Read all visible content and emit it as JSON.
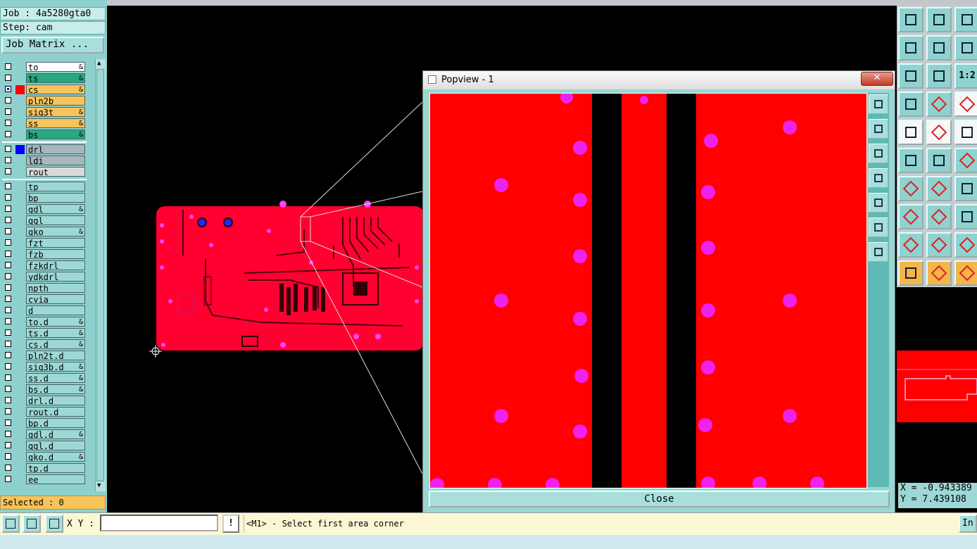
{
  "job": {
    "job_text": "Job : 4a5280gta0",
    "step_text": "Step: cam",
    "matrix_button": "Job Matrix ..."
  },
  "layers_top": [
    {
      "name": "to",
      "color": "#ffffff",
      "swatch": "",
      "checked": false,
      "mark": "&"
    },
    {
      "name": "ts",
      "color": "#2aa880",
      "swatch": "",
      "checked": false,
      "mark": "&"
    },
    {
      "name": "cs",
      "color": "#f7c35a",
      "swatch": "#ff0000",
      "checked": true,
      "mark": "&"
    },
    {
      "name": "pln2b",
      "color": "#f7c35a",
      "swatch": "",
      "checked": false,
      "mark": ""
    },
    {
      "name": "sig3t",
      "color": "#f7c35a",
      "swatch": "",
      "checked": false,
      "mark": "&"
    },
    {
      "name": "ss",
      "color": "#f7c35a",
      "swatch": "",
      "checked": false,
      "mark": "&"
    },
    {
      "name": "bs",
      "color": "#2aa880",
      "swatch": "",
      "checked": false,
      "mark": "&"
    }
  ],
  "layers_drill": [
    {
      "name": "drl",
      "color": "#aab6bd",
      "swatch": "#0000ff",
      "checked": false,
      "mark": ""
    },
    {
      "name": "ldi",
      "color": "#aab6bd",
      "swatch": "",
      "checked": false,
      "mark": ""
    },
    {
      "name": "rout",
      "color": "#d9d9d9",
      "swatch": "",
      "checked": false,
      "mark": ""
    }
  ],
  "layers_misc": [
    {
      "name": "tp",
      "mark": ""
    },
    {
      "name": "bp",
      "mark": ""
    },
    {
      "name": "gdl",
      "mark": "&"
    },
    {
      "name": "ggl",
      "mark": ""
    },
    {
      "name": "gko",
      "mark": "&"
    },
    {
      "name": "fzt",
      "mark": ""
    },
    {
      "name": "fzb",
      "mark": ""
    },
    {
      "name": "fzkdrl",
      "mark": ""
    },
    {
      "name": "ydkdrl",
      "mark": ""
    },
    {
      "name": "npth",
      "mark": ""
    },
    {
      "name": "cvia",
      "mark": ""
    },
    {
      "name": "d",
      "mark": ""
    },
    {
      "name": "to.d",
      "mark": "&"
    },
    {
      "name": "ts.d",
      "mark": "&"
    },
    {
      "name": "cs.d",
      "mark": "&"
    },
    {
      "name": "pln2t.d",
      "mark": ""
    },
    {
      "name": "sig3b.d",
      "mark": "&"
    },
    {
      "name": "ss.d",
      "mark": "&"
    },
    {
      "name": "bs.d",
      "mark": "&"
    },
    {
      "name": "drl.d",
      "mark": ""
    },
    {
      "name": "rout.d",
      "mark": ""
    },
    {
      "name": "bp.d",
      "mark": ""
    },
    {
      "name": "gdl.d",
      "mark": "&"
    },
    {
      "name": "ggl.d",
      "mark": ""
    },
    {
      "name": "gko.d",
      "mark": "&"
    },
    {
      "name": "tp.d",
      "mark": ""
    },
    {
      "name": "ee",
      "mark": ""
    }
  ],
  "selected_text": "Selected : 0",
  "popview": {
    "title": "Popview - 1",
    "close_x": "✕",
    "close_label": "Close"
  },
  "right_toolbar": {
    "zoom_label": "1:2"
  },
  "coords": {
    "x": "X = -0.943389",
    "y": "Y = 7.439108"
  },
  "bottom": {
    "xy_label": "X Y :",
    "xy_value": "",
    "warn": "!",
    "prompt": "<M1> - Select first area corner",
    "right_button": "In"
  },
  "colors": {
    "copper": "#ff0000",
    "pad": "#ff33ff",
    "drill": "#0000ff",
    "panel": "#8ed0cd"
  }
}
